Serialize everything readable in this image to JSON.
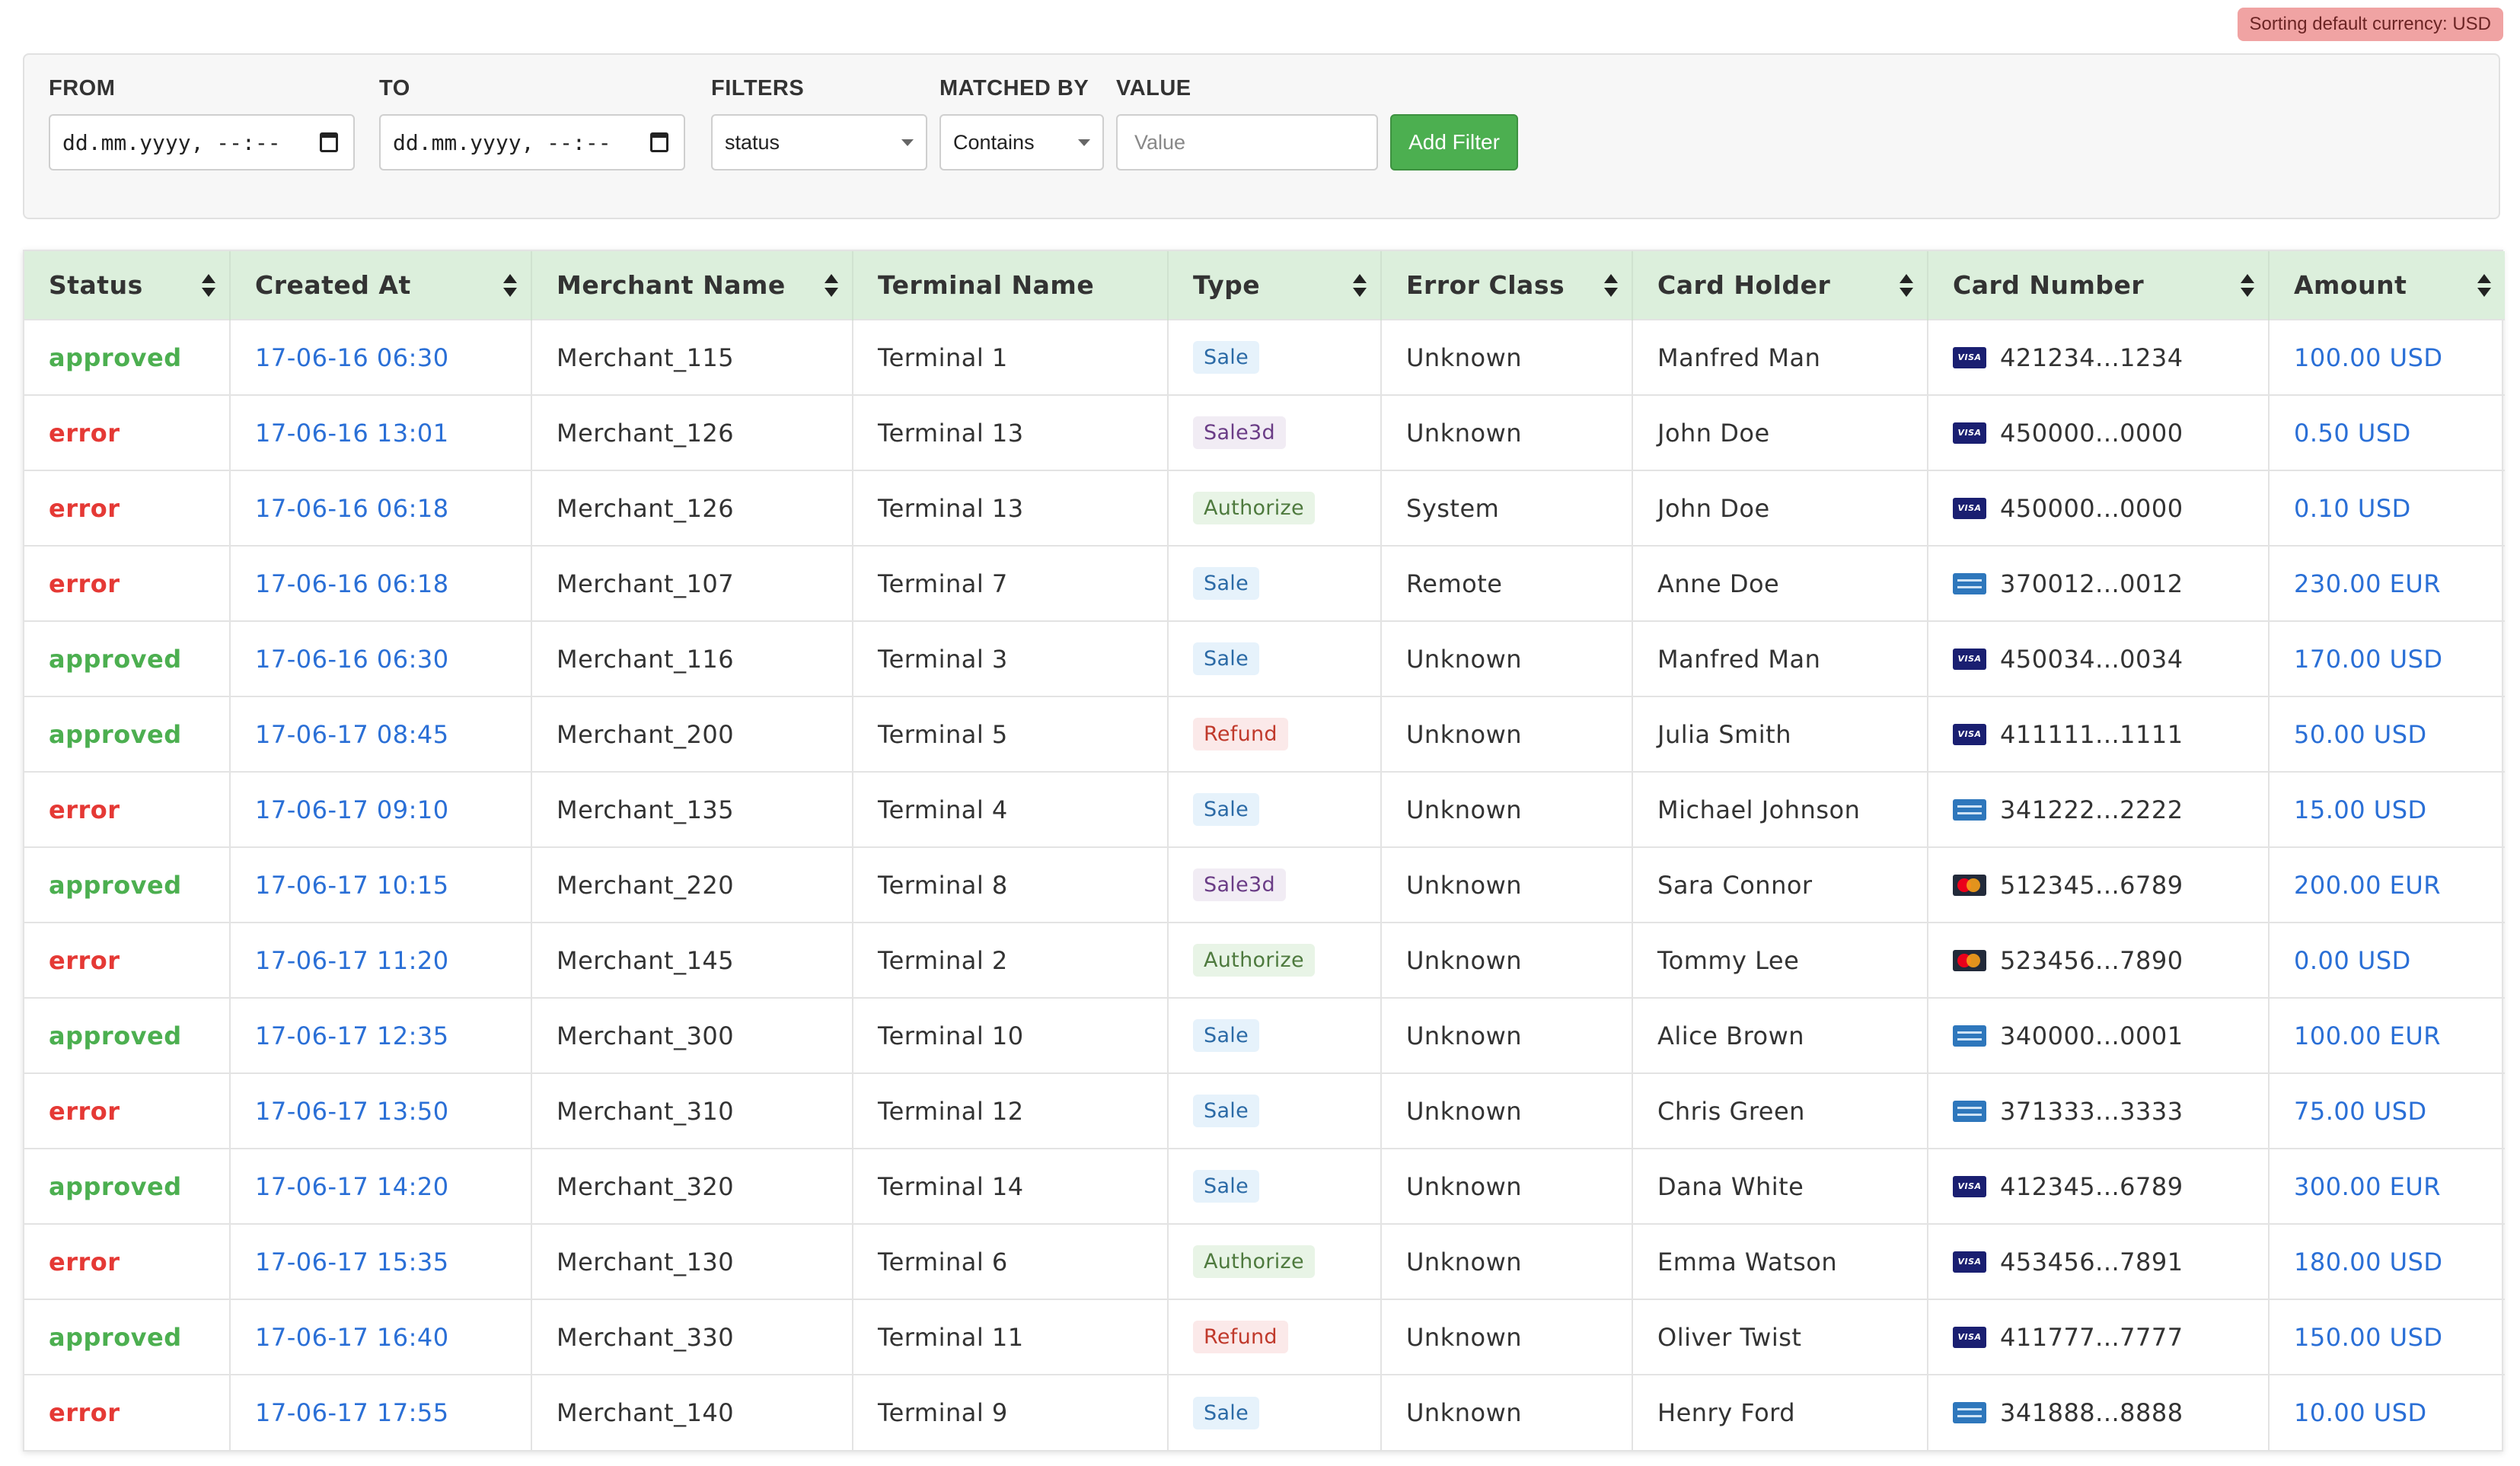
{
  "currency_badge": "Sorting default currency: USD",
  "filters": {
    "from_label": "FROM",
    "from_value": "dd.mm.yyyy, --:--",
    "to_label": "TO",
    "to_value": "dd.mm.yyyy, --:--",
    "filters_label": "FILTERS",
    "filters_value": "status",
    "matched_label": "MATCHED BY",
    "matched_value": "Contains",
    "value_label": "VALUE",
    "value_placeholder": "Value",
    "add_button": "Add Filter"
  },
  "table": {
    "columns": [
      "Status",
      "Created At",
      "Merchant Name",
      "Terminal Name",
      "Type",
      "Error Class",
      "Card Holder",
      "Card Number",
      "Amount"
    ],
    "rows": [
      {
        "status": "approved",
        "created": "17-06-16 06:30",
        "merchant": "Merchant_115",
        "terminal": "Terminal 1",
        "type": "Sale",
        "error_class": "Unknown",
        "holder": "Manfred Man",
        "card_brand": "visa",
        "card": "421234...1234",
        "amount": "100.00 USD"
      },
      {
        "status": "error",
        "created": "17-06-16 13:01",
        "merchant": "Merchant_126",
        "terminal": "Terminal 13",
        "type": "Sale3d",
        "error_class": "Unknown",
        "holder": "John Doe",
        "card_brand": "visa",
        "card": "450000...0000",
        "amount": "0.50 USD"
      },
      {
        "status": "error",
        "created": "17-06-16 06:18",
        "merchant": "Merchant_126",
        "terminal": "Terminal 13",
        "type": "Authorize",
        "error_class": "System",
        "holder": "John Doe",
        "card_brand": "visa",
        "card": "450000...0000",
        "amount": "0.10 USD"
      },
      {
        "status": "error",
        "created": "17-06-16 06:18",
        "merchant": "Merchant_107",
        "terminal": "Terminal 7",
        "type": "Sale",
        "error_class": "Remote",
        "holder": "Anne Doe",
        "card_brand": "amex",
        "card": "370012...0012",
        "amount": "230.00 EUR"
      },
      {
        "status": "approved",
        "created": "17-06-16 06:30",
        "merchant": "Merchant_116",
        "terminal": "Terminal 3",
        "type": "Sale",
        "error_class": "Unknown",
        "holder": "Manfred Man",
        "card_brand": "visa",
        "card": "450034...0034",
        "amount": "170.00 USD"
      },
      {
        "status": "approved",
        "created": "17-06-17 08:45",
        "merchant": "Merchant_200",
        "terminal": "Terminal 5",
        "type": "Refund",
        "error_class": "Unknown",
        "holder": "Julia Smith",
        "card_brand": "visa",
        "card": "411111...1111",
        "amount": "50.00 USD"
      },
      {
        "status": "error",
        "created": "17-06-17 09:10",
        "merchant": "Merchant_135",
        "terminal": "Terminal 4",
        "type": "Sale",
        "error_class": "Unknown",
        "holder": "Michael Johnson",
        "card_brand": "amex",
        "card": "341222...2222",
        "amount": "15.00 USD"
      },
      {
        "status": "approved",
        "created": "17-06-17 10:15",
        "merchant": "Merchant_220",
        "terminal": "Terminal 8",
        "type": "Sale3d",
        "error_class": "Unknown",
        "holder": "Sara Connor",
        "card_brand": "mastercard",
        "card": "512345...6789",
        "amount": "200.00 EUR"
      },
      {
        "status": "error",
        "created": "17-06-17 11:20",
        "merchant": "Merchant_145",
        "terminal": "Terminal 2",
        "type": "Authorize",
        "error_class": "Unknown",
        "holder": "Tommy Lee",
        "card_brand": "mastercard",
        "card": "523456...7890",
        "amount": "0.00 USD"
      },
      {
        "status": "approved",
        "created": "17-06-17 12:35",
        "merchant": "Merchant_300",
        "terminal": "Terminal 10",
        "type": "Sale",
        "error_class": "Unknown",
        "holder": "Alice Brown",
        "card_brand": "amex",
        "card": "340000...0001",
        "amount": "100.00 EUR"
      },
      {
        "status": "error",
        "created": "17-06-17 13:50",
        "merchant": "Merchant_310",
        "terminal": "Terminal 12",
        "type": "Sale",
        "error_class": "Unknown",
        "holder": "Chris Green",
        "card_brand": "amex",
        "card": "371333...3333",
        "amount": "75.00 USD"
      },
      {
        "status": "approved",
        "created": "17-06-17 14:20",
        "merchant": "Merchant_320",
        "terminal": "Terminal 14",
        "type": "Sale",
        "error_class": "Unknown",
        "holder": "Dana White",
        "card_brand": "visa",
        "card": "412345...6789",
        "amount": "300.00 EUR"
      },
      {
        "status": "error",
        "created": "17-06-17 15:35",
        "merchant": "Merchant_130",
        "terminal": "Terminal 6",
        "type": "Authorize",
        "error_class": "Unknown",
        "holder": "Emma Watson",
        "card_brand": "visa",
        "card": "453456...7891",
        "amount": "180.00 USD"
      },
      {
        "status": "approved",
        "created": "17-06-17 16:40",
        "merchant": "Merchant_330",
        "terminal": "Terminal 11",
        "type": "Refund",
        "error_class": "Unknown",
        "holder": "Oliver Twist",
        "card_brand": "visa",
        "card": "411777...7777",
        "amount": "150.00 USD"
      },
      {
        "status": "error",
        "created": "17-06-17 17:55",
        "merchant": "Merchant_140",
        "terminal": "Terminal 9",
        "type": "Sale",
        "error_class": "Unknown",
        "holder": "Henry Ford",
        "card_brand": "amex",
        "card": "341888...8888",
        "amount": "10.00 USD"
      }
    ]
  },
  "colors": {
    "approved": "#4caf50",
    "error": "#e53935",
    "link": "#2a6fd6",
    "header_bg": "#dcefdc",
    "add_button": "#4caf50"
  }
}
